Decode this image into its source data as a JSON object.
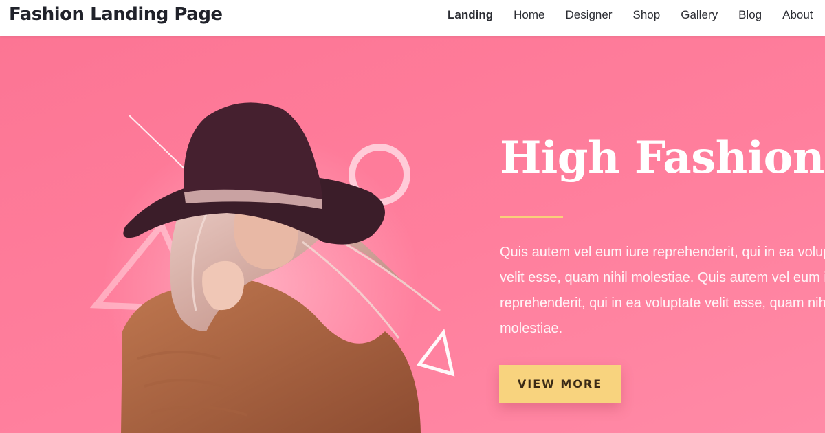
{
  "header": {
    "brand": "Fashion Landing Page",
    "nav": [
      {
        "label": "Landing",
        "active": true
      },
      {
        "label": "Home"
      },
      {
        "label": "Designer"
      },
      {
        "label": "Shop"
      },
      {
        "label": "Gallery"
      },
      {
        "label": "Blog"
      },
      {
        "label": "About"
      }
    ]
  },
  "hero": {
    "title": "High Fashion",
    "paragraph": "Quis autem vel eum iure reprehenderit, qui in ea voluptate velit esse, quam nihil molestiae. Quis autem vel eum iure reprehenderit, qui in ea voluptate velit esse, quam nihil molestiae.",
    "cta_label": "VIEW MORE",
    "model_photo": "woman-in-wide-brim-hat-photo",
    "decorations": [
      "diagonal-line",
      "ring-shape",
      "triangle-outline-large",
      "triangle-outline-small"
    ]
  },
  "colors": {
    "hero_background": "#fc7594",
    "accent": "#f9d07a",
    "button": "#f8d37e",
    "text_dark": "#20222a"
  }
}
